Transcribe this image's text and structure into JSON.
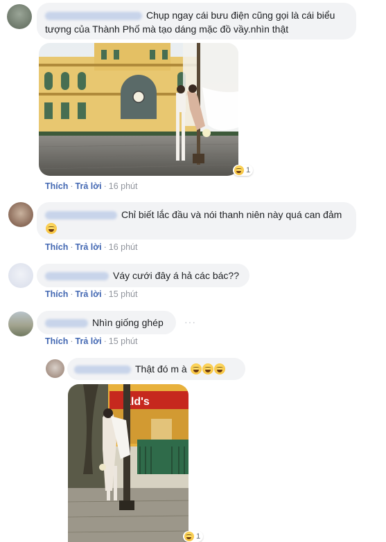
{
  "colors": {
    "link": "#4267b2",
    "meta": "#90949c",
    "bubble": "#f2f3f5"
  },
  "comments": [
    {
      "text": "Chụp ngay cái bưu điện cũng gọi là cái biểu tượng của Thành Phố mà tạo dáng mặc đồ vầy.nhìn thật",
      "photo_reaction_count": "1",
      "like": "Thích",
      "reply": "Trả lời",
      "time": "16 phút"
    },
    {
      "text": "Chỉ biết lắc đầu và nói thanh niên này quá can đảm",
      "like": "Thích",
      "reply": "Trả lời",
      "time": "16 phút"
    },
    {
      "text": "Váy cưới đây á hả các bác??",
      "like": "Thích",
      "reply": "Trả lời",
      "time": "15 phút"
    },
    {
      "text": "Nhìn giống ghép",
      "more": "···",
      "like": "Thích",
      "reply": "Trả lời",
      "time": "15 phút"
    }
  ],
  "reply": {
    "text": "Thật đó m à",
    "sign_text": "ald's",
    "photo_reaction_count": "1"
  }
}
